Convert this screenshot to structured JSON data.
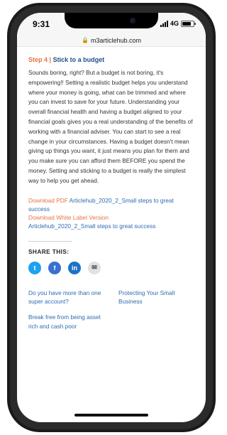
{
  "status_bar": {
    "time": "9:31",
    "network": "4G"
  },
  "browser": {
    "url": "m3articlehub.com"
  },
  "step": {
    "number": "Step 4",
    "separator": "|",
    "title": "Stick to a budget"
  },
  "article": {
    "text": "Sounds boring, right? But a budget is not boring, it's empowering!! Setting a realistic budget helps you understand where your money is going, what can be trimmed and where you can invest to save for your future. Understanding your overall financial health and having a budget aligned to your financial goals gives you a real understanding of the benefits of working with a financial adviser. You can start to see a real change in your circumstances. Having a budget doesn't mean giving up things you want, it just means you plan for them and you make sure you can afford them BEFORE you spend the money. Setting and sticking to a budget is really the simplest way to help you get ahead."
  },
  "downloads": {
    "pdf_label": "Download PDF",
    "pdf_link": "Articlehub_2020_2_Small steps to great success",
    "wl_label": "Download White Label Version",
    "wl_link": "Articlehub_2020_2_Small steps to great success"
  },
  "share": {
    "title": "SHARE THIS:",
    "buttons": [
      {
        "icon": "twitter-icon",
        "glyph": "t"
      },
      {
        "icon": "facebook-icon",
        "glyph": "f"
      },
      {
        "icon": "linkedin-icon",
        "glyph": "in"
      },
      {
        "icon": "email-icon",
        "glyph": "✉"
      }
    ]
  },
  "related": {
    "left": [
      "Do you have more than one super account?",
      "Break free from being asset rich and cash poor"
    ],
    "right": [
      "Protecting Your Small Business"
    ]
  },
  "colors": {
    "accent_orange": "#e8733f",
    "link_blue": "#2d6bb0",
    "title_blue": "#1e4f8c"
  }
}
